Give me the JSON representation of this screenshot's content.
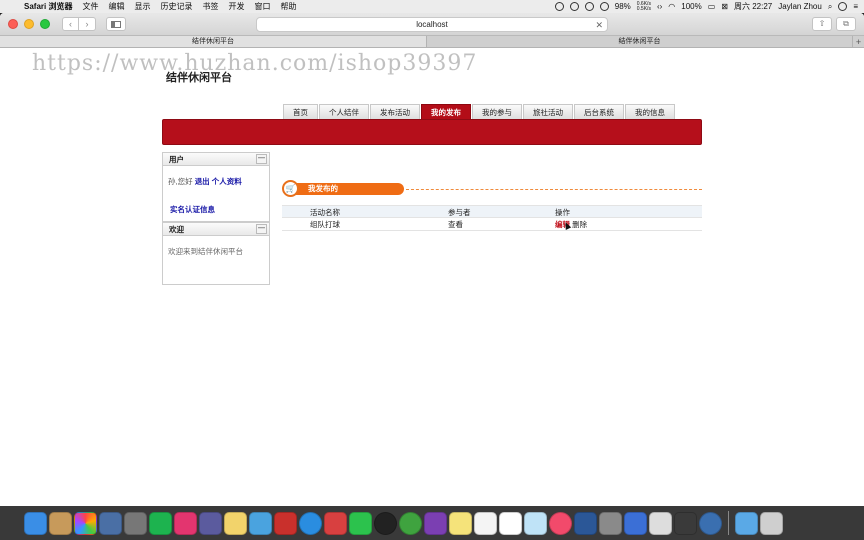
{
  "menubar": {
    "app_name": "Safari 浏览器",
    "items": [
      "文件",
      "编辑",
      "显示",
      "历史记录",
      "书签",
      "开发",
      "窗口",
      "帮助"
    ],
    "battery": "98%",
    "net_up": "0.6K/s",
    "net_down": "0.5K/s",
    "brightness": "100%",
    "datetime": "周六 22:27",
    "user": "Jaylan Zhou"
  },
  "browser": {
    "address": "localhost",
    "tabs": [
      "结伴休闲平台",
      "结伴休闲平台"
    ],
    "new_tab": "+"
  },
  "watermark": "https://www.huzhan.com/ishop39397",
  "site": {
    "title": "结伴休闲平台",
    "nav": [
      "首页",
      "个人结伴",
      "发布活动",
      "我的发布",
      "我的参与",
      "旅社活动",
      "后台系统",
      "我的信息"
    ],
    "active_nav_index": 3
  },
  "sidebar": {
    "user_panel": {
      "title": "用户",
      "greeting": "孙,您好",
      "logout": "退出",
      "profile": "个人资料",
      "verify": "实名认证信息"
    },
    "welcome_panel": {
      "title": "欢迎",
      "text": "欢迎来到结伴休闲平台"
    },
    "collapse_symbol": "—"
  },
  "main": {
    "section_title": "我发布的",
    "table": {
      "headers": [
        "活动名称",
        "参与者",
        "操作"
      ],
      "rows": [
        {
          "name": "组队打球",
          "participants": "查看",
          "edit": "编辑",
          "delete": "删除"
        }
      ]
    }
  },
  "colors": {
    "brand_red": "#b50f1b",
    "accent_orange": "#ef6c14",
    "link_blue": "#1a1aa8"
  }
}
